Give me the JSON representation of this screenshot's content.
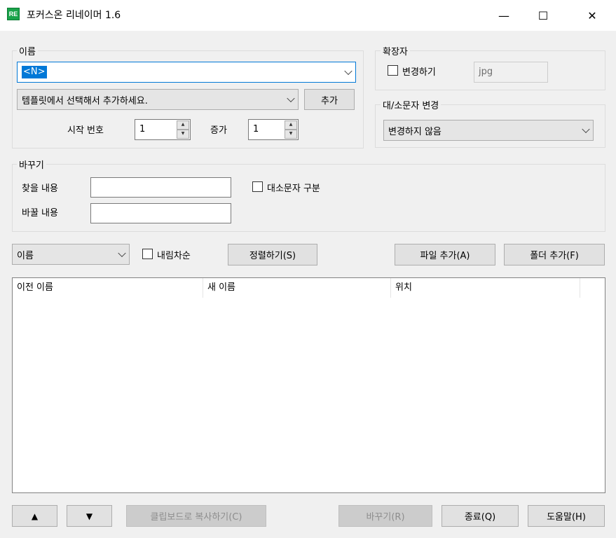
{
  "window": {
    "icon_text": "RE",
    "title": "포커스온 리네이머 1.6",
    "minimize": "—",
    "maximize": "☐",
    "close": "✕"
  },
  "name_group": {
    "label": "이름",
    "name_value": "<N>",
    "template_select": "템플릿에서 선택해서 추가하세요.",
    "add_button": "추가",
    "start_label": "시작 번호",
    "start_value": "1",
    "increment_label": "증가",
    "increment_value": "1"
  },
  "ext_group": {
    "label": "확장자",
    "change_label": "변경하기",
    "ext_value": "jpg"
  },
  "case_group": {
    "label": "대/소문자 변경",
    "selected": "변경하지 않음"
  },
  "replace_group": {
    "label": "바꾸기",
    "find_label": "찾을 내용",
    "find_value": "",
    "replace_label": "바꿀 내용",
    "replace_value": "",
    "match_case_label": "대소문자 구분"
  },
  "sort": {
    "selected": "이름",
    "descending_label": "내림차순",
    "sort_button": "정렬하기(S)",
    "add_file_button": "파일 추가(A)",
    "add_folder_button": "폴더 추가(F)"
  },
  "list": {
    "columns": [
      "이전 이름",
      "새 이름",
      "위치"
    ]
  },
  "bottom": {
    "up_button": "▲",
    "down_button": "▼",
    "copy_button": "클립보드로 복사하기(C)",
    "rename_button": "바꾸기(R)",
    "exit_button": "종료(Q)",
    "help_button": "도움말(H)"
  }
}
